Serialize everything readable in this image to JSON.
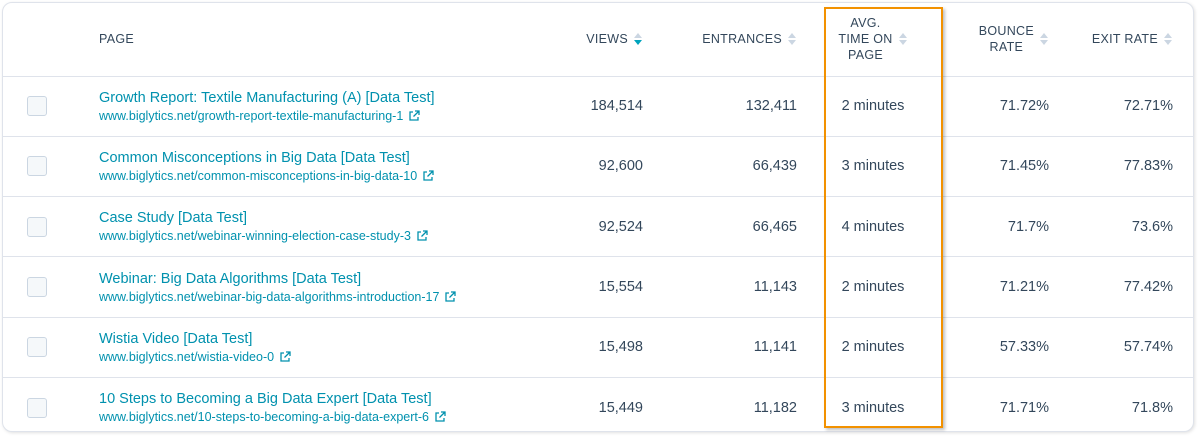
{
  "columns": {
    "page": "PAGE",
    "views": "VIEWS",
    "entrances": "ENTRANCES",
    "avg_time": [
      "AVG.",
      "TIME ON",
      "PAGE"
    ],
    "bounce": [
      "BOUNCE",
      "RATE"
    ],
    "exit_rate": "EXIT RATE"
  },
  "sort": {
    "column": "views",
    "direction": "descending"
  },
  "highlight_color": "#f29100",
  "link_color": "#0091ae",
  "rows": [
    {
      "title": "Growth Report: Textile Manufacturing (A) [Data Test]",
      "url": "www.biglytics.net/growth-report-textile-manufacturing-1",
      "views": "184,514",
      "entrances": "132,411",
      "avg_time": "2 minutes",
      "bounce": "71.72%",
      "exit_rate": "72.71%"
    },
    {
      "title": "Common Misconceptions in Big Data [Data Test]",
      "url": "www.biglytics.net/common-misconceptions-in-big-data-10",
      "views": "92,600",
      "entrances": "66,439",
      "avg_time": "3 minutes",
      "bounce": "71.45%",
      "exit_rate": "77.83%"
    },
    {
      "title": "Case Study [Data Test]",
      "url": "www.biglytics.net/webinar-winning-election-case-study-3",
      "views": "92,524",
      "entrances": "66,465",
      "avg_time": "4 minutes",
      "bounce": "71.7%",
      "exit_rate": "73.6%"
    },
    {
      "title": "Webinar: Big Data Algorithms [Data Test]",
      "url": "www.biglytics.net/webinar-big-data-algorithms-introduction-17",
      "views": "15,554",
      "entrances": "11,143",
      "avg_time": "2 minutes",
      "bounce": "71.21%",
      "exit_rate": "77.42%"
    },
    {
      "title": "Wistia Video [Data Test]",
      "url": "www.biglytics.net/wistia-video-0",
      "views": "15,498",
      "entrances": "11,141",
      "avg_time": "2 minutes",
      "bounce": "57.33%",
      "exit_rate": "57.74%"
    },
    {
      "title": "10 Steps to Becoming a Big Data Expert [Data Test]",
      "url": "www.biglytics.net/10-steps-to-becoming-a-big-data-expert-6",
      "views": "15,449",
      "entrances": "11,182",
      "avg_time": "3 minutes",
      "bounce": "71.71%",
      "exit_rate": "71.8%"
    }
  ]
}
